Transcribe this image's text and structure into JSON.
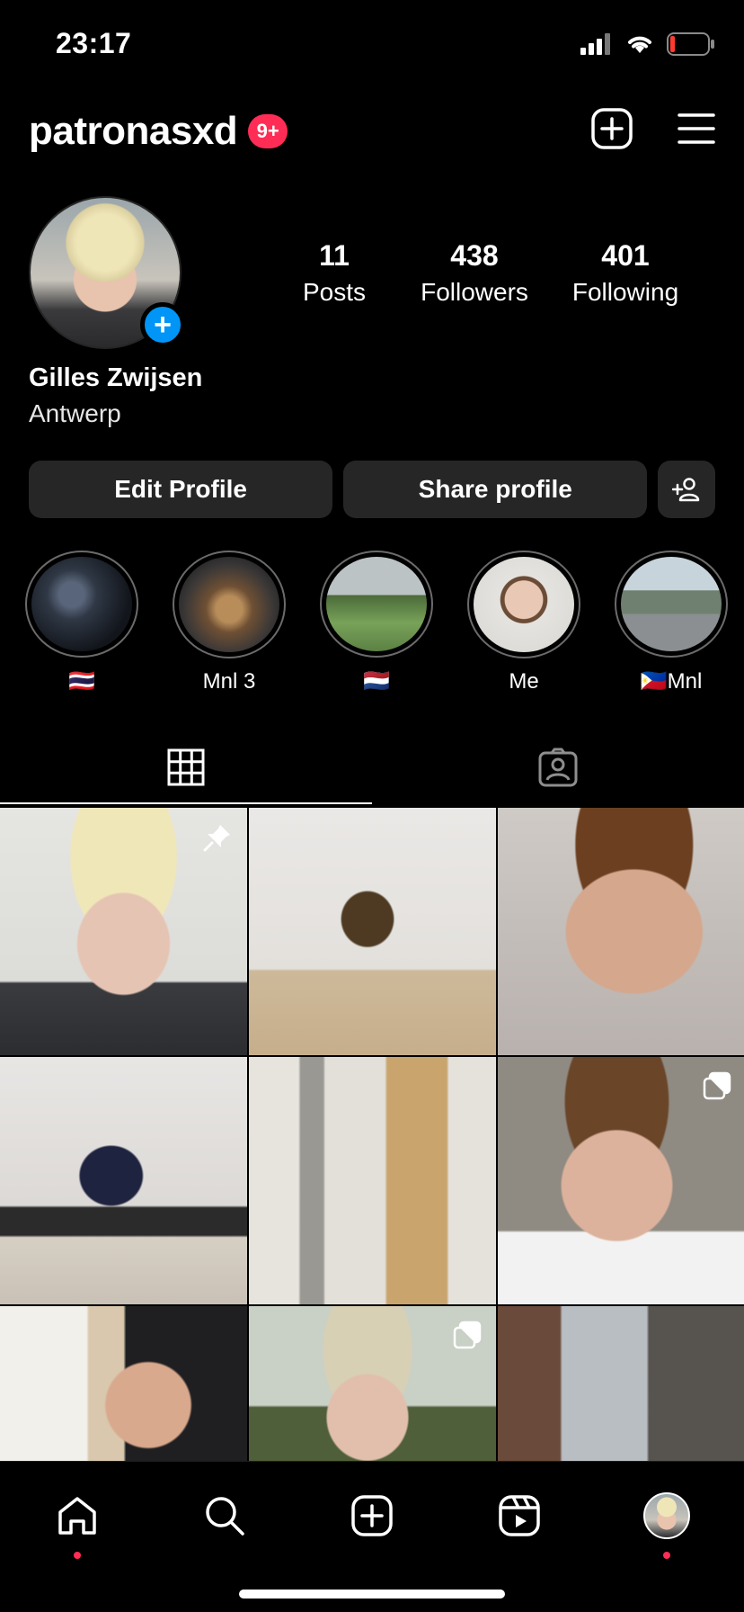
{
  "status_bar": {
    "time": "23:17"
  },
  "header": {
    "username": "patronasxd",
    "notification_badge": "9+"
  },
  "profile": {
    "display_name": "Gilles Zwijsen",
    "location": "Antwerp",
    "avatar_add_symbol": "+",
    "stats": {
      "posts": {
        "value": "11",
        "label": "Posts"
      },
      "followers": {
        "value": "438",
        "label": "Followers"
      },
      "following": {
        "value": "401",
        "label": "Following"
      }
    }
  },
  "actions": {
    "edit_profile": "Edit Profile",
    "share_profile": "Share profile"
  },
  "highlights": [
    {
      "label": "🇹🇭"
    },
    {
      "label": "Mnl 3"
    },
    {
      "label": "🇳🇱"
    },
    {
      "label": "Me"
    },
    {
      "label": "🇵🇭Mnl"
    }
  ],
  "tabs": {
    "active": "grid"
  },
  "colors": {
    "badge": "#ff2d55",
    "accent": "#0095f6",
    "button_bg": "#262626",
    "background": "#000000"
  },
  "icons": {
    "header": [
      "new-post-icon",
      "menu-icon"
    ],
    "nav": [
      "home-icon",
      "search-icon",
      "create-icon",
      "reels-icon",
      "profile-avatar"
    ],
    "tabs": [
      "grid-icon",
      "tagged-icon"
    ]
  }
}
